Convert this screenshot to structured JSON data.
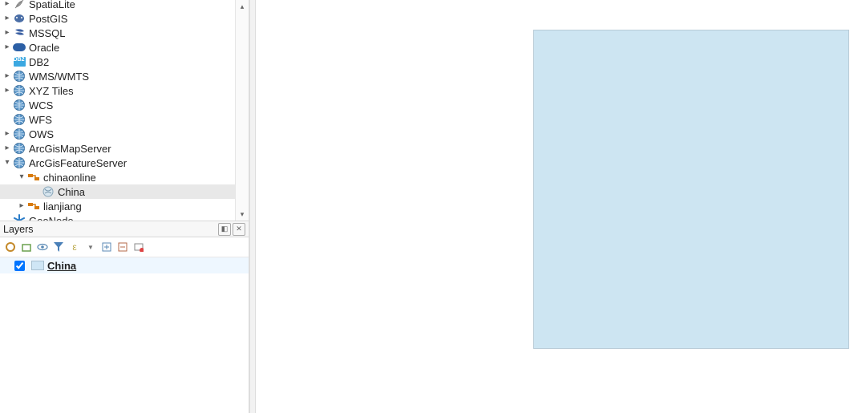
{
  "browser": {
    "items": [
      {
        "label": "SpatiaLite",
        "icon": "feather",
        "arrow": "right",
        "indent": 0
      },
      {
        "label": "PostGIS",
        "icon": "elephant",
        "arrow": "right",
        "indent": 0
      },
      {
        "label": "MSSQL",
        "icon": "mssql",
        "arrow": "right",
        "indent": 0
      },
      {
        "label": "Oracle",
        "icon": "oracle",
        "arrow": "right",
        "indent": 0
      },
      {
        "label": "DB2",
        "icon": "db2",
        "arrow": "blank",
        "indent": 0
      },
      {
        "label": "WMS/WMTS",
        "icon": "globe",
        "arrow": "right",
        "indent": 0
      },
      {
        "label": "XYZ Tiles",
        "icon": "globe",
        "arrow": "right",
        "indent": 0
      },
      {
        "label": "WCS",
        "icon": "globe",
        "arrow": "blank",
        "indent": 0
      },
      {
        "label": "WFS",
        "icon": "globe",
        "arrow": "blank",
        "indent": 0
      },
      {
        "label": "OWS",
        "icon": "globe",
        "arrow": "right",
        "indent": 0
      },
      {
        "label": "ArcGisMapServer",
        "icon": "globe",
        "arrow": "right",
        "indent": 0
      },
      {
        "label": "ArcGisFeatureServer",
        "icon": "globe",
        "arrow": "down",
        "indent": 0
      },
      {
        "label": "chinaonline",
        "icon": "connector",
        "arrow": "down",
        "indent": 1
      },
      {
        "label": "China",
        "icon": "layer-globe",
        "arrow": "blank",
        "indent": 2,
        "selected": true
      },
      {
        "label": "lianjiang",
        "icon": "connector",
        "arrow": "right",
        "indent": 1
      },
      {
        "label": "GeoNode",
        "icon": "geonode",
        "arrow": "blank",
        "indent": 0
      }
    ]
  },
  "layers_panel": {
    "title": "Layers",
    "layer_name": "China"
  }
}
